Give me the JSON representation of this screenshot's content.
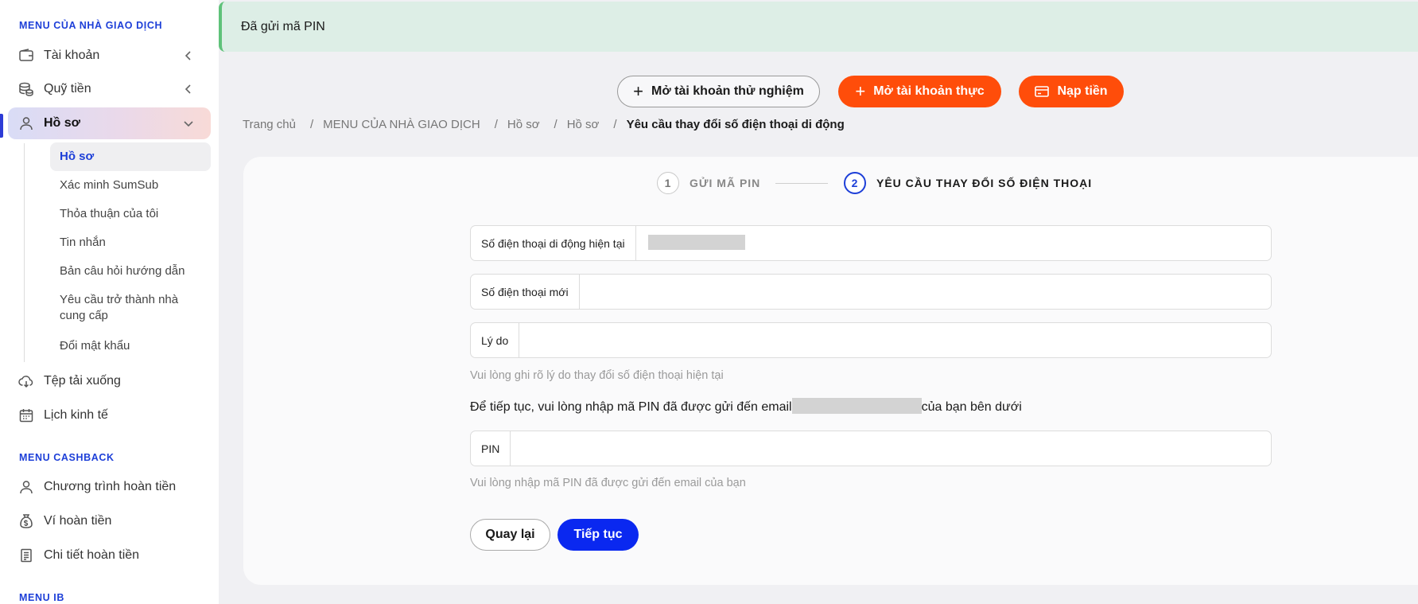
{
  "sidebar": {
    "trader_menu_title": "MENU CỦA NHÀ GIAO DỊCH",
    "items": [
      {
        "label": "Tài khoản",
        "icon": "wallet-icon"
      },
      {
        "label": "Quỹ tiền",
        "icon": "coins-icon"
      },
      {
        "label": "Hồ sơ",
        "icon": "user-icon"
      }
    ],
    "profile_sub": [
      "Hồ sơ",
      "Xác minh SumSub",
      "Thỏa thuận của tôi",
      "Tin nhắn",
      "Bản câu hỏi hướng dẫn",
      "Yêu cầu trở thành nhà cung cấp",
      "Đổi mật khẩu"
    ],
    "more_items": [
      {
        "label": "Tệp tải xuống",
        "icon": "cloud-download-icon"
      },
      {
        "label": "Lịch kinh tế",
        "icon": "calendar-icon"
      }
    ],
    "cashback_title": "MENU CASHBACK",
    "cashback_items": [
      {
        "label": "Chương trình hoàn tiền",
        "icon": "user-icon"
      },
      {
        "label": "Ví hoàn tiền",
        "icon": "money-bag-icon"
      },
      {
        "label": "Chi tiết hoàn tiền",
        "icon": "document-icon"
      }
    ],
    "ib_title": "MENU IB"
  },
  "alert": {
    "text": "Đã gửi mã PIN",
    "color": "#5fc27a"
  },
  "top_buttons": {
    "demo": "Mở tài khoản thử nghiệm",
    "real": "Mở tài khoản thực",
    "deposit": "Nạp tiền",
    "accent": "#ff4d0a"
  },
  "breadcrumb": [
    "Trang chủ",
    "MENU CỦA NHÀ GIAO DỊCH",
    "Hồ sơ",
    "Hồ sơ",
    "Yêu cầu thay đổi số điện thoại di động"
  ],
  "stepper": [
    {
      "num": "1",
      "label": "GỬI MÃ PIN"
    },
    {
      "num": "2",
      "label": "YÊU CẦU THAY ĐỔI SỐ ĐIỆN THOẠI"
    }
  ],
  "form": {
    "current_phone_label": "Số điện thoại di động hiện tại",
    "new_phone_label": "Số điện thoại mới",
    "reason_label": "Lý do",
    "reason_hint": "Vui lòng ghi rõ lý do thay đổi số điện thoại hiện tại",
    "instruction_before": "Để tiếp tục, vui lòng nhập mã PIN đã được gửi đến email",
    "instruction_after": "của bạn bên dưới",
    "pin_label": "PIN",
    "pin_hint": "Vui lòng nhập mã PIN đã được gửi đến email của bạn",
    "back": "Quay lại",
    "next": "Tiếp tục",
    "primary_color": "#0a28f0"
  }
}
